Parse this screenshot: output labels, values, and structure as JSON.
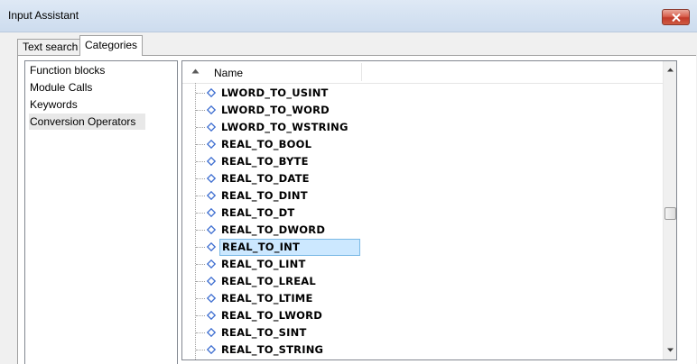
{
  "window": {
    "title": "Input Assistant"
  },
  "tabs": [
    {
      "label": "Text search"
    },
    {
      "label": "Categories"
    }
  ],
  "categories": [
    {
      "label": "Function blocks"
    },
    {
      "label": "Module Calls"
    },
    {
      "label": "Keywords"
    },
    {
      "label": "Conversion Operators",
      "selected": true
    }
  ],
  "tree": {
    "column_header": "Name",
    "items": [
      {
        "label": "LWORD_TO_USINT"
      },
      {
        "label": "LWORD_TO_WORD"
      },
      {
        "label": "LWORD_TO_WSTRING"
      },
      {
        "label": "REAL_TO_BOOL"
      },
      {
        "label": "REAL_TO_BYTE"
      },
      {
        "label": "REAL_TO_DATE"
      },
      {
        "label": "REAL_TO_DINT"
      },
      {
        "label": "REAL_TO_DT"
      },
      {
        "label": "REAL_TO_DWORD"
      },
      {
        "label": "REAL_TO_INT",
        "selected": true
      },
      {
        "label": "REAL_TO_LINT"
      },
      {
        "label": "REAL_TO_LREAL"
      },
      {
        "label": "REAL_TO_LTIME"
      },
      {
        "label": "REAL_TO_LWORD"
      },
      {
        "label": "REAL_TO_SINT"
      },
      {
        "label": "REAL_TO_STRING"
      }
    ]
  },
  "colors": {
    "selection_fill": "#cce8ff",
    "selection_border": "#7ab9e5",
    "icon_diamond": "#3f6fd1"
  }
}
